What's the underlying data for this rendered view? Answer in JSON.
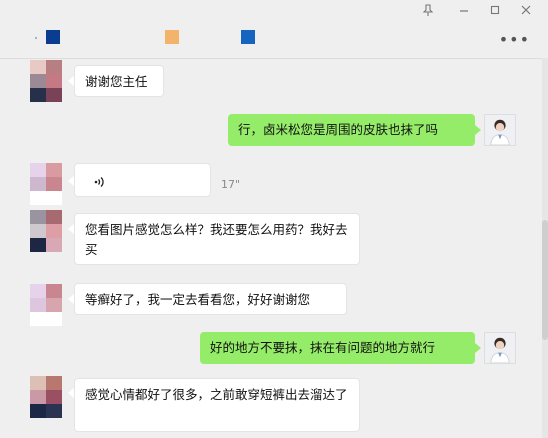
{
  "window": {
    "controls": [
      "pin-icon",
      "minimize-icon",
      "maximize-icon",
      "close-icon"
    ]
  },
  "header": {
    "name_blocks": [
      {
        "color": "#0a3d8f"
      },
      {
        "color": "#f4b36a"
      },
      {
        "color": "#1565c0"
      }
    ],
    "more_icon": "more-icon"
  },
  "messages": [
    {
      "side": "left",
      "text": "谢谢您主任"
    },
    {
      "side": "right",
      "text": "行，卤米松您是周围的皮肤也抹了吗"
    },
    {
      "side": "left",
      "type": "voice",
      "duration": "17\""
    },
    {
      "side": "left",
      "text": "您看图片感觉怎么样？我还要怎么用药？我好去买"
    },
    {
      "side": "left",
      "text": "等癣好了，我一定去看看您，好好谢谢您"
    },
    {
      "side": "right",
      "text": "好的地方不要抹，抹在有问题的地方就行"
    },
    {
      "side": "left",
      "text": "感觉心情都好了很多，之前敢穿短裤出去溜达了"
    }
  ],
  "colors": {
    "background": "#efefef",
    "bubble_self": "#95ec69",
    "bubble_other": "#ffffff"
  }
}
